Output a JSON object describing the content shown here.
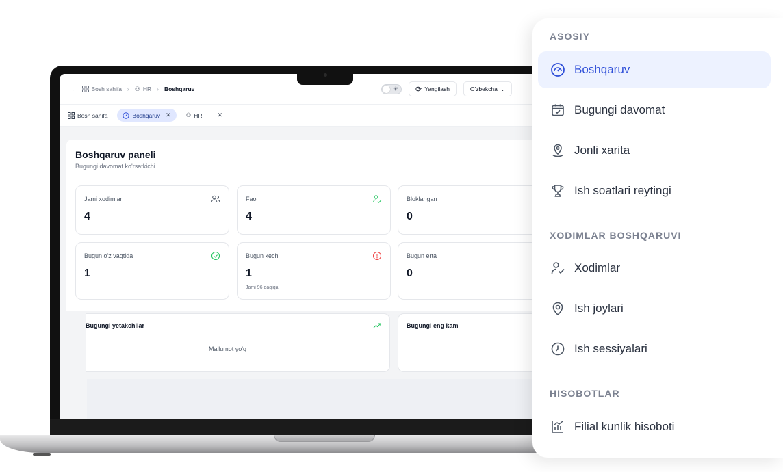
{
  "topbar": {
    "crumbs": [
      "Bosh sahifa",
      "HR",
      "Boshqaruv"
    ],
    "refresh_label": "Yangilash",
    "language": "O'zbekcha"
  },
  "tabs": [
    {
      "label": "Bosh sahifa"
    },
    {
      "label": "Boshqaruv",
      "active": true
    },
    {
      "label": "HR"
    }
  ],
  "panel": {
    "title": "Boshqaruv paneli",
    "subtitle": "Bugungi davomat ko'rsatkichi"
  },
  "stats": [
    {
      "label": "Jami xodimlar",
      "value": "4"
    },
    {
      "label": "Faol",
      "value": "4"
    },
    {
      "label": "Bloklangan",
      "value": "0"
    },
    {
      "label": "Bugun o'z vaqtida",
      "value": "1"
    },
    {
      "label": "Bugun kech",
      "value": "1",
      "note": "Jami 96 daqiqa"
    },
    {
      "label": "Bugun erta",
      "value": "0"
    }
  ],
  "leaders": {
    "title": "Bugungi yetakchilar",
    "empty": "Ma'lumot yo'q"
  },
  "least": {
    "title": "Bugungi eng kam"
  },
  "sidebar": {
    "sections": [
      {
        "title": "ASOSIY"
      },
      {
        "title": "XODIMLAR BOSHQARUVI"
      },
      {
        "title": "HISOBOTLAR"
      }
    ],
    "items": [
      {
        "label": "Boshqaruv",
        "icon": "gauge-icon"
      },
      {
        "label": "Bugungi davomat",
        "icon": "calendar-check-icon"
      },
      {
        "label": "Jonli xarita",
        "icon": "map-pin-icon"
      },
      {
        "label": "Ish soatlari reytingi",
        "icon": "trophy-icon"
      },
      {
        "label": "Xodimlar",
        "icon": "user-check-icon"
      },
      {
        "label": "Ish joylari",
        "icon": "location-icon"
      },
      {
        "label": "Ish sessiyalari",
        "icon": "clock-icon"
      },
      {
        "label": "Filial kunlik hisoboti",
        "icon": "bar-chart-icon"
      }
    ]
  },
  "colors": {
    "accent": "#2f4fd8",
    "active_bg": "#edf2ff",
    "success": "#22c55e",
    "danger": "#ef4444"
  }
}
